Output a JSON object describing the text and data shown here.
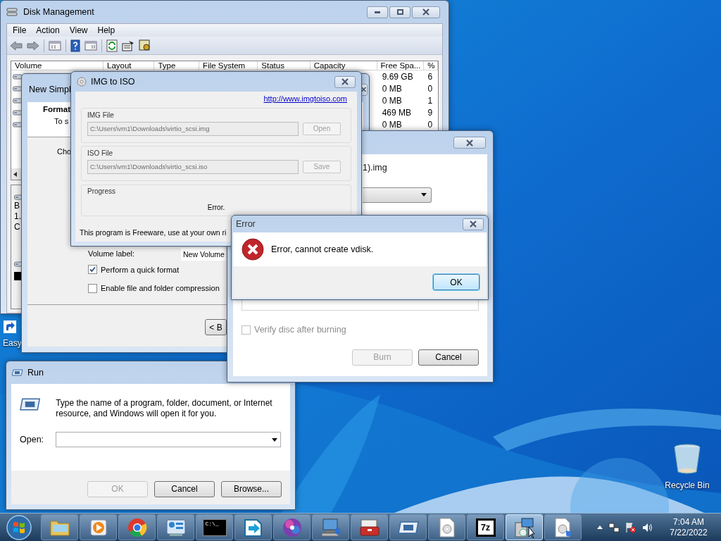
{
  "desktop": {
    "icons": [
      {
        "kind": "shortcut",
        "label": "Easy"
      },
      {
        "kind": "recycle-bin",
        "label": "Recycle Bin"
      }
    ]
  },
  "disk_management": {
    "title": "Disk Management",
    "menu": [
      "File",
      "Action",
      "View",
      "Help"
    ],
    "columns": [
      "Volume",
      "Layout",
      "Type",
      "File System",
      "Status",
      "Capacity",
      "Free Spa...",
      "%"
    ],
    "rows": [
      {
        "free_space": "9.69 GB",
        "percent": "6"
      },
      {
        "free_space": "0 MB",
        "percent": "0"
      },
      {
        "free_space": "0 MB",
        "percent": "1"
      },
      {
        "free_space": "469 MB",
        "percent": "9"
      },
      {
        "free_space": "0 MB",
        "percent": "0"
      }
    ],
    "disk_info": [
      "B",
      "1.",
      "C"
    ]
  },
  "new_volume_wizard": {
    "title": "New Simpl",
    "heading": "Format",
    "subheading": "To s",
    "prompt": "Cho",
    "volume_label": {
      "label": "Volume label:",
      "value": "New Volume"
    },
    "options": [
      {
        "label": "Perform a quick format",
        "checked": true
      },
      {
        "label": "Enable file and folder compression",
        "checked": false
      }
    ],
    "back_button": "< B"
  },
  "burn_window": {
    "file_name": "1).img",
    "verify": {
      "label": "Verify disc after burning",
      "checked": false,
      "disabled": true
    },
    "buttons": [
      {
        "label": "Burn",
        "disabled": true
      },
      {
        "label": "Cancel",
        "disabled": false
      }
    ]
  },
  "img_to_iso": {
    "title": "IMG to ISO",
    "link": "http://www.imgtoiso.com",
    "groups": [
      {
        "label": "IMG File",
        "path": "C:\\Users\\vm1\\Downloads\\virtio_scsi.img",
        "button": "Open"
      },
      {
        "label": "ISO File",
        "path": "C:\\Users\\vm1\\Downloads\\virtio_scsi.iso",
        "button": "Save"
      }
    ],
    "progress": {
      "label": "Progress",
      "status": "Error."
    },
    "footer": "This program is Freeware, use at your own ri"
  },
  "error_dialog": {
    "title": "Error",
    "message": "Error, cannot create vdisk.",
    "button": "OK"
  },
  "run_dialog": {
    "title": "Run",
    "description": "Type the name of a program, folder, document, or Internet resource, and Windows will open it for you.",
    "open_label": "Open:",
    "buttons": [
      {
        "label": "OK",
        "disabled": true
      },
      {
        "label": "Cancel",
        "disabled": false
      },
      {
        "label": "Browse...",
        "disabled": false
      }
    ]
  },
  "taskbar": {
    "apps": [
      {
        "kind": "folder",
        "selected": false
      },
      {
        "kind": "media",
        "selected": false
      },
      {
        "kind": "chrome",
        "selected": false
      },
      {
        "kind": "control",
        "selected": false
      },
      {
        "kind": "cmd",
        "label": "C:\\_",
        "selected": false
      },
      {
        "kind": "arrow",
        "selected": false
      },
      {
        "kind": "disc",
        "selected": false
      },
      {
        "kind": "computer",
        "selected": false
      },
      {
        "kind": "toolbox",
        "selected": false
      },
      {
        "kind": "run",
        "selected": false
      },
      {
        "kind": "cd-file",
        "selected": false
      },
      {
        "kind": "sevenzip",
        "label": "7z",
        "selected": false
      },
      {
        "kind": "setup",
        "selected": true
      },
      {
        "kind": "disc-file",
        "selected": false
      }
    ],
    "time": "7:04 AM",
    "date": "7/22/2022"
  }
}
